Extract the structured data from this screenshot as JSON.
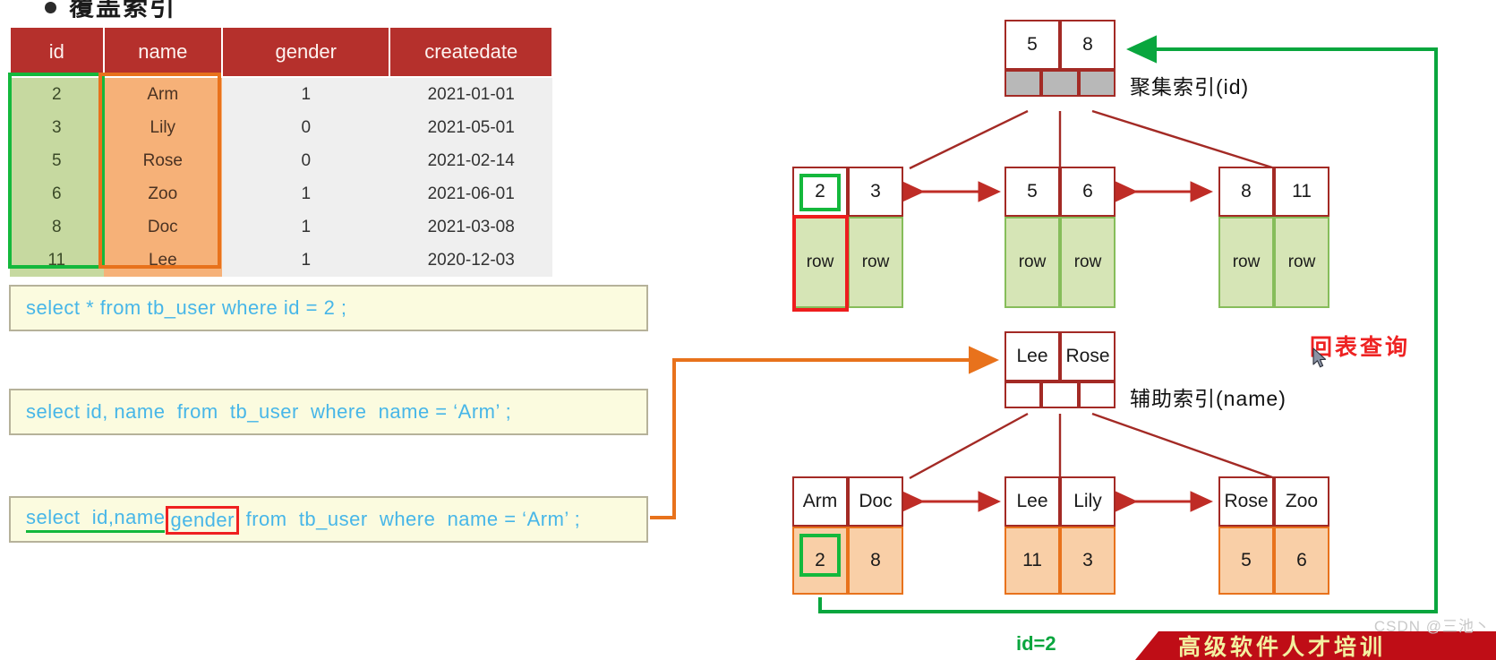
{
  "slide": {
    "heading": "覆盖索引",
    "bullet_icon": "bullet-dot-icon"
  },
  "table": {
    "columns": [
      "id",
      "name",
      "gender",
      "createdate"
    ],
    "rows": [
      {
        "id": "2",
        "name": "Arm",
        "gender": "1",
        "createdate": "2021-01-01"
      },
      {
        "id": "3",
        "name": "Lily",
        "gender": "0",
        "createdate": "2021-05-01"
      },
      {
        "id": "5",
        "name": "Rose",
        "gender": "0",
        "createdate": "2021-02-14"
      },
      {
        "id": "6",
        "name": "Zoo",
        "gender": "1",
        "createdate": "2021-06-01"
      },
      {
        "id": "8",
        "name": "Doc",
        "gender": "1",
        "createdate": "2021-03-08"
      },
      {
        "id": "11",
        "name": "Lee",
        "gender": "1",
        "createdate": "2020-12-03"
      }
    ],
    "highlight_id_color": "#14b83c",
    "highlight_name_color": "#e8721c",
    "header_color": "#b5302c"
  },
  "sql": {
    "stmt1": "select * from tb_user where id = 2 ;",
    "stmt2": "select id, name  from  tb_user  where  name = ‘Arm’ ;",
    "stmt3": {
      "prefix": "select  id,name",
      "boxed": "gender",
      "suffix": " from  tb_user  where  name = ‘Arm’ ;",
      "underline_part": "id,name"
    }
  },
  "clustered_index": {
    "label": "聚集索引(id)",
    "root_keys": [
      "5",
      "8"
    ],
    "leaves": [
      {
        "keys": [
          "2",
          "3"
        ],
        "data": [
          "row",
          "row"
        ]
      },
      {
        "keys": [
          "5",
          "6"
        ],
        "data": [
          "row",
          "row"
        ]
      },
      {
        "keys": [
          "8",
          "11"
        ],
        "data": [
          "row",
          "row"
        ]
      }
    ]
  },
  "secondary_index": {
    "label": "辅助索引(name)",
    "root_keys": [
      "Lee",
      "Rose"
    ],
    "leaves": [
      {
        "keys": [
          "Arm",
          "Doc"
        ],
        "data": [
          "2",
          "8"
        ]
      },
      {
        "keys": [
          "Lee",
          "Lily"
        ],
        "data": [
          "11",
          "3"
        ]
      },
      {
        "keys": [
          "Rose",
          "Zoo"
        ],
        "data": [
          "5",
          "6"
        ]
      }
    ]
  },
  "annotations": {
    "back_to_table": "回表查询",
    "id_equals": "id=2",
    "back_to_table_color": "#ee2222",
    "green_path_color": "#09a63e",
    "orange_path_color": "#e8721c"
  },
  "footer": {
    "banner_text": "高级软件人才培训",
    "watermark": "CSDN @三池丶"
  }
}
